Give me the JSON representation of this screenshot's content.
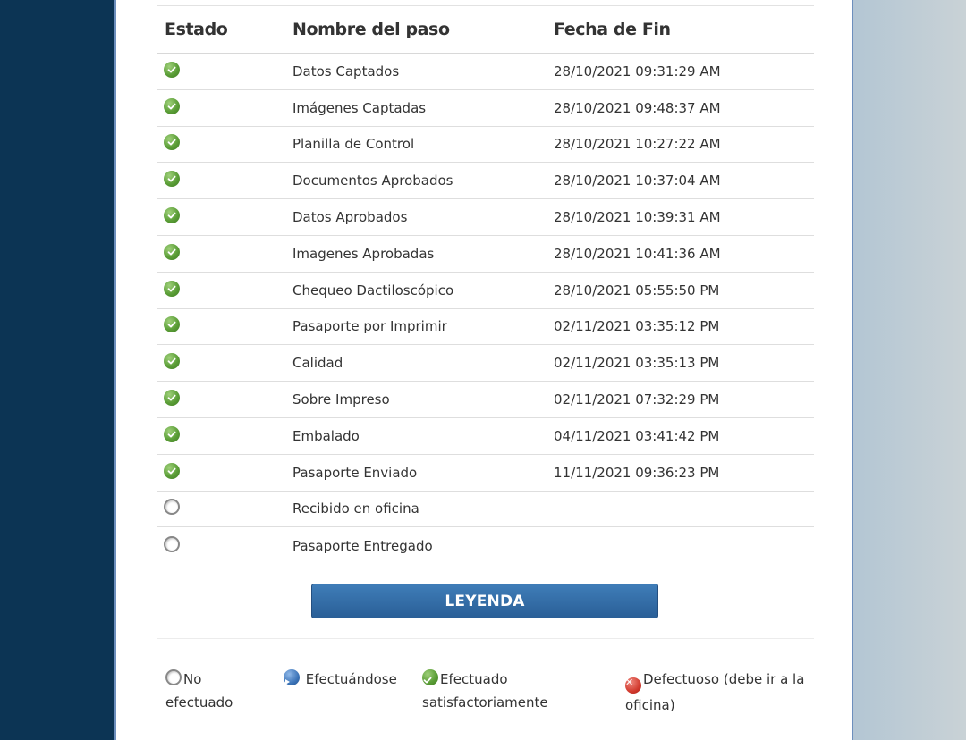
{
  "table": {
    "headers": {
      "status": "Estado",
      "step": "Nombre del paso",
      "end_date": "Fecha de Fin"
    },
    "rows": [
      {
        "status": "ok",
        "step": "Datos Captados",
        "end_date": "28/10/2021 09:31:29 AM"
      },
      {
        "status": "ok",
        "step": "Imágenes Captadas",
        "end_date": "28/10/2021 09:48:37 AM"
      },
      {
        "status": "ok",
        "step": "Planilla de Control",
        "end_date": "28/10/2021 10:27:22 AM"
      },
      {
        "status": "ok",
        "step": "Documentos Aprobados",
        "end_date": "28/10/2021 10:37:04 AM"
      },
      {
        "status": "ok",
        "step": "Datos Aprobados",
        "end_date": "28/10/2021 10:39:31 AM"
      },
      {
        "status": "ok",
        "step": "Imagenes Aprobadas",
        "end_date": "28/10/2021 10:41:36 AM"
      },
      {
        "status": "ok",
        "step": "Chequeo Dactiloscópico",
        "end_date": "28/10/2021 05:55:50 PM"
      },
      {
        "status": "ok",
        "step": "Pasaporte por Imprimir",
        "end_date": "02/11/2021 03:35:12 PM"
      },
      {
        "status": "ok",
        "step": "Calidad",
        "end_date": "02/11/2021 03:35:13 PM"
      },
      {
        "status": "ok",
        "step": "Sobre Impreso",
        "end_date": "02/11/2021 07:32:29 PM"
      },
      {
        "status": "ok",
        "step": "Embalado",
        "end_date": "04/11/2021 03:41:42 PM"
      },
      {
        "status": "ok",
        "step": "Pasaporte Enviado",
        "end_date": "11/11/2021 09:36:23 PM"
      },
      {
        "status": "none",
        "step": "Recibido en oficina",
        "end_date": ""
      },
      {
        "status": "none",
        "step": "Pasaporte Entregado",
        "end_date": ""
      }
    ]
  },
  "legend_button": {
    "label": "LEYENDA"
  },
  "legend": {
    "not_done": {
      "line1": "No",
      "line2": "efectuado"
    },
    "in_progress": {
      "line1": "Efectuándose"
    },
    "done": {
      "line1": "Efectuado",
      "line2": "satisfactoriamente"
    },
    "defective": {
      "line1": "Defectuoso (debe ir a la",
      "line2": "oficina)"
    }
  },
  "icons": {
    "ok": "check-circle-icon",
    "none": "empty-circle-icon",
    "in_progress": "play-circle-icon",
    "defective": "x-circle-icon"
  },
  "colors": {
    "accent": "#2f6aa3",
    "ok": "#5b9e37",
    "error": "#d23a2e"
  }
}
